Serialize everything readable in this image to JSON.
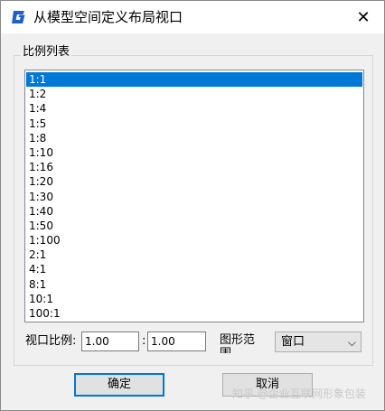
{
  "window": {
    "title": "从模型空间定义布局视口",
    "close_glyph": "✕"
  },
  "group": {
    "label": "比例列表"
  },
  "scale_list": {
    "selected_index": 0,
    "items": [
      "1:1",
      "1:2",
      "1:4",
      "1:5",
      "1:8",
      "1:10",
      "1:16",
      "1:20",
      "1:30",
      "1:40",
      "1:50",
      "1:100",
      "2:1",
      "4:1",
      "8:1",
      "10:1",
      "100:1"
    ]
  },
  "viewport_scale": {
    "label": "视口比例:",
    "left_value": "1.00",
    "separator": ":",
    "right_value": "1.00"
  },
  "range": {
    "label": "图形范围",
    "selected": "窗口"
  },
  "buttons": {
    "ok": "确定",
    "cancel": "取消"
  },
  "watermark": "知乎 @企业互联网形象包装",
  "colors": {
    "selection": "#0078d7",
    "icon_blue": "#1e5fc8"
  }
}
